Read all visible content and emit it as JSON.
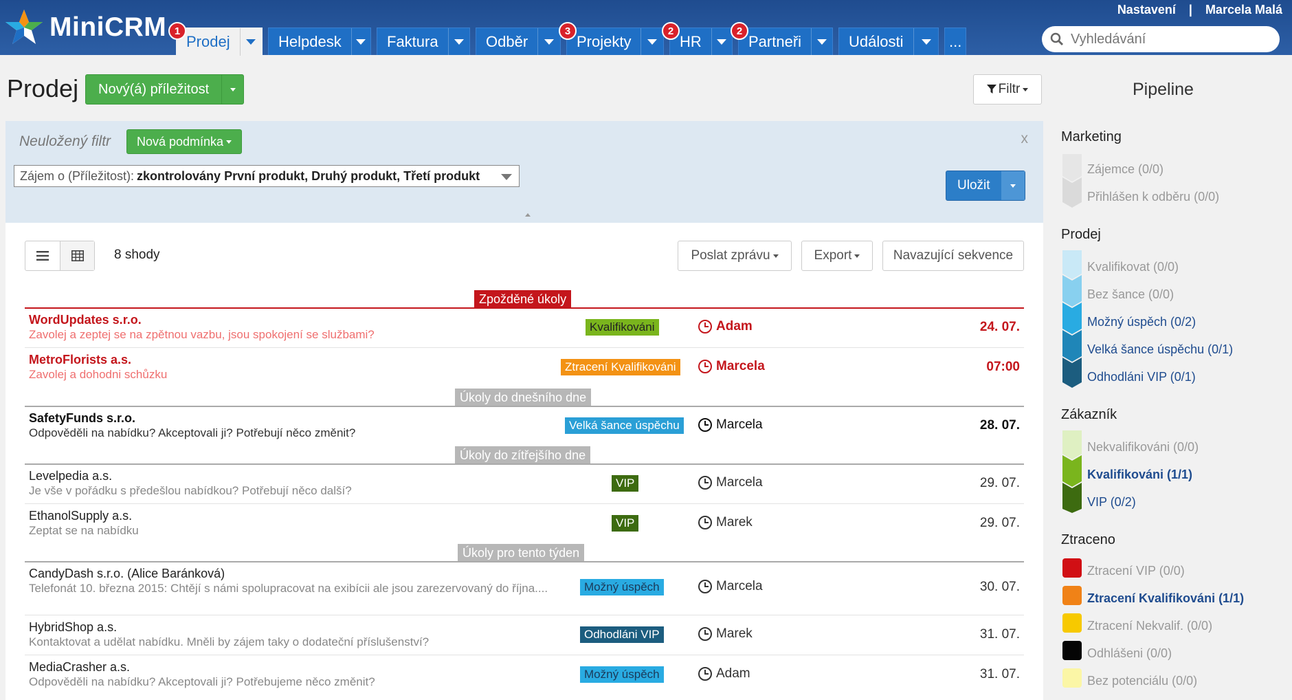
{
  "app": {
    "name": "MiniCRM"
  },
  "user_links": {
    "settings": "Nastavení",
    "separator": "|",
    "user": "Marcela Malá"
  },
  "search": {
    "placeholder": "Vyhledávání"
  },
  "nav": {
    "tabs": [
      {
        "label": "Prodej",
        "badge": "1"
      },
      {
        "label": "Helpdesk",
        "badge": ""
      },
      {
        "label": "Faktura",
        "badge": ""
      },
      {
        "label": "Odběr",
        "badge": ""
      },
      {
        "label": "Projekty",
        "badge": "3"
      },
      {
        "label": "HR",
        "badge": "2"
      },
      {
        "label": "Partneři",
        "badge": "2"
      },
      {
        "label": "Události",
        "badge": ""
      },
      {
        "label": "...",
        "badge": ""
      }
    ]
  },
  "header": {
    "title": "Prodej",
    "new_button": "Nový(á) příležitost",
    "filter_button": "Filtr"
  },
  "filter": {
    "unsaved_label": "Neuložený filtr",
    "new_condition": "Nová podmínka",
    "close": "x",
    "condition_prefix": "Zájem o (Příležitost):",
    "condition_value": "zkontrolovány První produkt, Druhý produkt, Třetí produkt",
    "save_button": "Uložit"
  },
  "toolbar": {
    "matches": "8 shody",
    "send_message": "Poslat zprávu",
    "export": "Export",
    "sequence": "Navazující sekvence"
  },
  "groups": {
    "late": "Zpožděné úkoly",
    "today": "Úkoly do dnešního dne",
    "tomorrow": "Úkoly do zítřejšího dne",
    "week": "Úkoly pro tento týden"
  },
  "rows": [
    {
      "company": "WordUpdates s.r.o.",
      "task": "Zavolej a zeptej se na zpětnou vazbu, jsou spokojení se službami?",
      "stage": "Kvalifikováni",
      "owner": "Adam",
      "date": "24. 07."
    },
    {
      "company": "MetroFlorists a.s.",
      "task": "Zavolej a dohodni schůzku",
      "stage": "Ztracení Kvalifikováni",
      "owner": "Marcela",
      "date": "07:00"
    },
    {
      "company": "SafetyFunds s.r.o.",
      "task": "Odpověděli na nabídku? Akceptovali ji? Potřebují něco změnit?",
      "stage": "Velká šance úspěchu",
      "owner": "Marcela",
      "date": "28. 07."
    },
    {
      "company": "Levelpedia a.s.",
      "task": "Je vše v pořádku s předešlou nabídkou? Potřebují něco další?",
      "stage": "VIP",
      "owner": "Marcela",
      "date": "29. 07."
    },
    {
      "company": "EthanolSupply a.s.",
      "task": "Zeptat se na nabídku",
      "stage": "VIP",
      "owner": "Marek",
      "date": "29. 07."
    },
    {
      "company": "CandyDash s.r.o. (Alice Baránková)",
      "task": "Telefonát 10. března 2015: Chtějí s námi spolupracovat na exibícii ale jsou zarezervovaný do října....",
      "stage": "Možný úspěch",
      "owner": "Marcela",
      "date": "30. 07."
    },
    {
      "company": "HybridShop a.s.",
      "task": "Kontaktovat a udělat nabídku. Mněli by zájem taky o dodateční příslušenství?",
      "stage": "Odhodláni VIP",
      "owner": "Marek",
      "date": "31. 07."
    },
    {
      "company": "MediaCrasher a.s.",
      "task": "Odpověděli na nabídku? Akceptovali ji? Potřebujeme něco změnit?",
      "stage": "Možný úspěch",
      "owner": "Adam",
      "date": "31. 07."
    }
  ],
  "pipeline": {
    "title": "Pipeline",
    "sections": [
      {
        "name": "Marketing",
        "items": [
          "Zájemce (0/0)",
          "Přihlášen k odběru (0/0)"
        ]
      },
      {
        "name": "Prodej",
        "items": [
          "Kvalifikovat (0/0)",
          "Bez šance (0/0)",
          "Možný úspěch (0/2)",
          "Velká šance úspěchu (0/1)",
          "Odhodláni VIP (0/1)"
        ]
      },
      {
        "name": "Zákazník",
        "items": [
          "Nekvalifikováni (0/0)",
          "Kvalifikováni (1/1)",
          "VIP (0/2)"
        ]
      },
      {
        "name": "Ztraceno",
        "items": [
          "Ztracení VIP (0/0)",
          "Ztracení Kvalifikováni (1/1)",
          "Ztracení Nekvalif. (0/0)",
          "Odhlášeni (0/0)",
          "Bez potenciálu (0/0)"
        ]
      }
    ]
  },
  "colors": {
    "nav_bg": "#1f4c8f",
    "tab": "#1f6fc5",
    "late_red": "#c4161c",
    "group_gray": "#b7b7b7",
    "green_button": "#4cae4c",
    "save_blue": "#2c7ec8",
    "stage_kvalifikovani": "#7ab51d",
    "stage_ztraceni": "#f39214",
    "stage_velka_sance": "#2a9fd6",
    "stage_vip": "#3d6b10",
    "stage_mozny": "#29abe2",
    "stage_odhodlani": "#1c5d7f"
  },
  "icons": {
    "clock": "clock-icon",
    "list": "list-view-icon",
    "table": "table-view-icon",
    "filter": "funnel-icon",
    "search": "search-icon"
  }
}
